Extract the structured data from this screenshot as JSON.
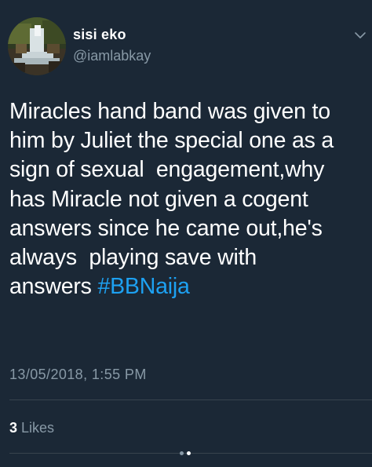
{
  "tweet": {
    "author": {
      "display_name": "sisi eko",
      "handle": "@iamlabkay",
      "avatar_icon": "waterfall-photo"
    },
    "text": "Miracles hand band was given to\nhim by Juliet the special one as a\nsign of sexual  engagement,why\nhas Miracle not given a cogent\nanswers since he came out,he's\nalways  playing save with\nanswers ",
    "hashtag": "#BBNaija",
    "timestamp": "13/05/2018, 1:55 PM",
    "likes": {
      "count": "3",
      "label": "Likes"
    },
    "menu_icon": "chevron-down-icon"
  },
  "pager": {
    "total": 2,
    "active": 2
  },
  "colors": {
    "background": "#1b2836",
    "primary_text": "#ffffff",
    "secondary_text": "#8899a6",
    "link": "#1da1f2",
    "divider": "#38444d"
  }
}
